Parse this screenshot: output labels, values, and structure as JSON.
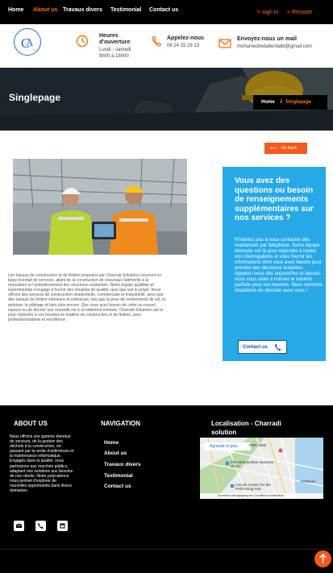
{
  "nav": {
    "items": [
      {
        "label": "Home",
        "active": false
      },
      {
        "label": "About us",
        "active": true
      },
      {
        "label": "Travaux divers",
        "active": false
      },
      {
        "label": "Testimonial",
        "active": false
      },
      {
        "label": "Contact us",
        "active": false
      }
    ],
    "sign_in": ">  sign in",
    "register": ">  Resister"
  },
  "header": {
    "hours": {
      "title_line1": "Heures",
      "title_line2": "d'ouverture",
      "line1": "Lundi - samedi",
      "line2": "9h00 à 18h00"
    },
    "phone": {
      "title": "Appelez-nous",
      "value": "06 24 15 29 13"
    },
    "email": {
      "title": "Envoyez-nous un mail",
      "value": "mohamedredabentaibi@gmail.com"
    }
  },
  "hero": {
    "title": "Singlepage",
    "breadcrumb_home": "Home",
    "breadcrumb_sep": "/",
    "breadcrumb_current": "Singlepage"
  },
  "go_back": "Go Back",
  "body_text": "Les travaux de construction et de finition proposés par Charradi Solutions couvrent un large éventail de services, allant de la construction de nouveaux bâtiments à la rénovation et l'embellissement des structures existantes. Notre équipe qualifiée et expérimentée s'engage à fournir des résultats de qualité, quel que soit le projet. Nous offrons des services de construction résidentielle, commerciale et industrielle, ainsi que des travaux de finition intérieure et extérieure, tels que la pose de revêtements de sol, la peinture, le plâtrage et bien plus encore. Que vous ayez besoin de créer un nouvel espace ou de donner une nouvelle vie à un bâtiment existant, Charradi Solutions est là pour répondre à vos besoins en matière de construction et de finition, avec professionnalisme et excellence.",
  "card": {
    "title": "Vous avez des questions ou besoin de renseignements supplémentaires sur nos services ?",
    "text": "N'hésitez pas à nous contacter dès maintenant par téléphone. Notre équipe dévouée est là pour répondre à toutes vos interrogations et vous fournir les informations dont vous avez besoin pour prendre des décisions éclairées. Appelez-nous dès aujourd'hui et laissez-nous vous aider à trouver la solution parfaite pour vos besoins. Nous sommes impatients de discuter avec vous !",
    "button": "Contact us"
  },
  "footer": {
    "about_title": "ABOUT US",
    "about_text": "Nous offrons une gamme étendue de services, de la gestion des déchets à la construction, en passant par la vente d'antiretours et la maintenance informatique. Engagés dans la qualité, nous participons aux marchés publics, adaptant nos solutions aux besoins de nos clients. Notre polyvalence nous permet d'explorer de nouvelles opportunités dans divers domaines.",
    "nav_title": "NAVIGATION",
    "nav_items": [
      "Home",
      "About us",
      "Travaux divers",
      "Testimonial",
      "Contact us"
    ],
    "map_title_line1": "Localisation - Charradi",
    "map_title_line2": "solution",
    "map": {
      "enlarge": "Agrandir le plan",
      "labels": [
        "PER SIDE",
        "The Metropolitan Museum of Art",
        "YORKVIL",
        "Lincoln Center for the Performing Arts"
      ],
      "footer": "Données cartographiques    Conditions d'utilisation"
    },
    "social_icons": [
      "email-icon",
      "phone-icon",
      "calendar-icon"
    ]
  },
  "colors": {
    "accent": "#f97316",
    "button_orange": "#f25a1e",
    "card_blue": "#27a9e8",
    "logo_blue": "#2a6db5"
  }
}
